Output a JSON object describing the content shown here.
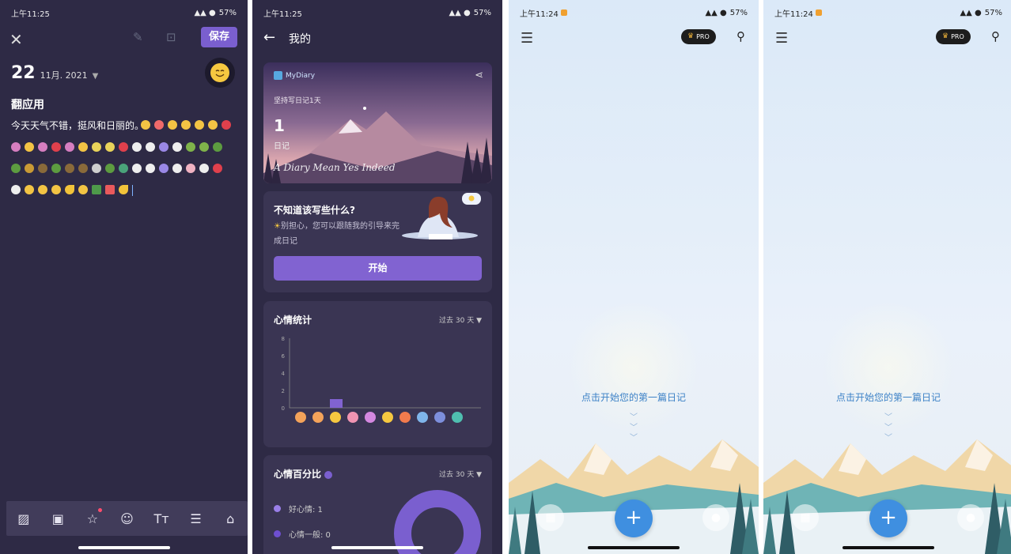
{
  "panel1": {
    "status": {
      "time": "上午11:25",
      "battery": "57%"
    },
    "save_label": "保存",
    "date": {
      "day": "22",
      "month_year": "11月. 2021"
    },
    "note_title": "翻应用",
    "note_text": "今天天气不错，挺风和日丽的。"
  },
  "panel2": {
    "status": {
      "time": "上午11:25",
      "battery": "57%"
    },
    "title": "我的",
    "hero": {
      "logo": "MyDiary",
      "streak_text": "坚持写日记1天",
      "count": "1",
      "unit": "日记",
      "script": "A Diary Mean Yes Indeed"
    },
    "prompt": {
      "title": "不知道该写些什么?",
      "subtitle": "别担心，您可以跟随我的引导来完成日记",
      "button": "开始"
    },
    "mood_stats": {
      "title": "心情统计",
      "range": "过去 30 天"
    },
    "mood_percent": {
      "title": "心情百分比",
      "range": "过去 30 天",
      "legend": [
        "好心情: 1",
        "心情一般: 0"
      ]
    },
    "chart_data": {
      "type": "bar",
      "categories": [
        "mood-1",
        "mood-2",
        "mood-3",
        "mood-4",
        "mood-5",
        "mood-6",
        "mood-7",
        "mood-8",
        "mood-9",
        "mood-10"
      ],
      "values": [
        0,
        0,
        1,
        0,
        0,
        0,
        0,
        0,
        0,
        0
      ],
      "yticks": [
        "8",
        "6",
        "4",
        "2",
        "0"
      ],
      "ylim": [
        0,
        8
      ],
      "bar_color": "#8163d1"
    }
  },
  "panel3": {
    "status": {
      "time": "上午11:24",
      "battery": "57%"
    },
    "pro_label": "PRO",
    "cta": "点击开始您的第一篇日记",
    "fab": "+"
  },
  "panel4": {
    "status": {
      "time": "上午11:24",
      "battery": "57%"
    },
    "pro_label": "PRO",
    "cta": "点击开始您的第一篇日记",
    "fab": "+"
  }
}
